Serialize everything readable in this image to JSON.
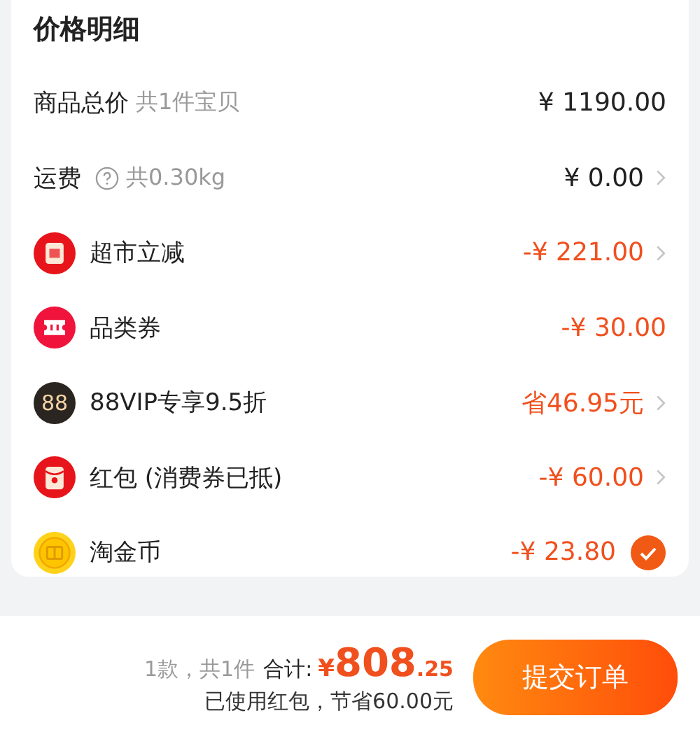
{
  "title": "价格明细",
  "rows": [
    {
      "label": "商品总价",
      "note": "共1件宝贝",
      "help": false,
      "amount": "¥ 1190.00",
      "discount": false,
      "arrow": false
    },
    {
      "label": "运费",
      "note": "共0.30kg",
      "help": true,
      "amount": "¥ 0.00",
      "discount": false,
      "arrow": true
    },
    {
      "kind": "reduce",
      "label": "超市立减",
      "amount": "-¥ 221.00",
      "discount": true,
      "arrow": true
    },
    {
      "kind": "ticket",
      "label": "品类券",
      "amount": "-¥ 30.00",
      "discount": true,
      "arrow": false
    },
    {
      "kind": "vip",
      "icon_text": "88",
      "label": "88VIP专享9.5折",
      "amount": "省46.95元",
      "discount": true,
      "arrow": true
    },
    {
      "kind": "envelope",
      "label": "红包 (消费券已抵)",
      "amount": "-¥ 60.00",
      "discount": true,
      "arrow": true
    },
    {
      "kind": "coin",
      "label": "淘金币",
      "amount": "-¥ 23.80",
      "discount": true,
      "arrow": false,
      "checked": true
    }
  ],
  "footer": {
    "count": "1款，共1件",
    "total_label": "合计:",
    "currency": "¥",
    "total_int": "808",
    "total_dec": ".25",
    "savings": "已使用红包，节省60.00元",
    "submit": "提交订单"
  }
}
